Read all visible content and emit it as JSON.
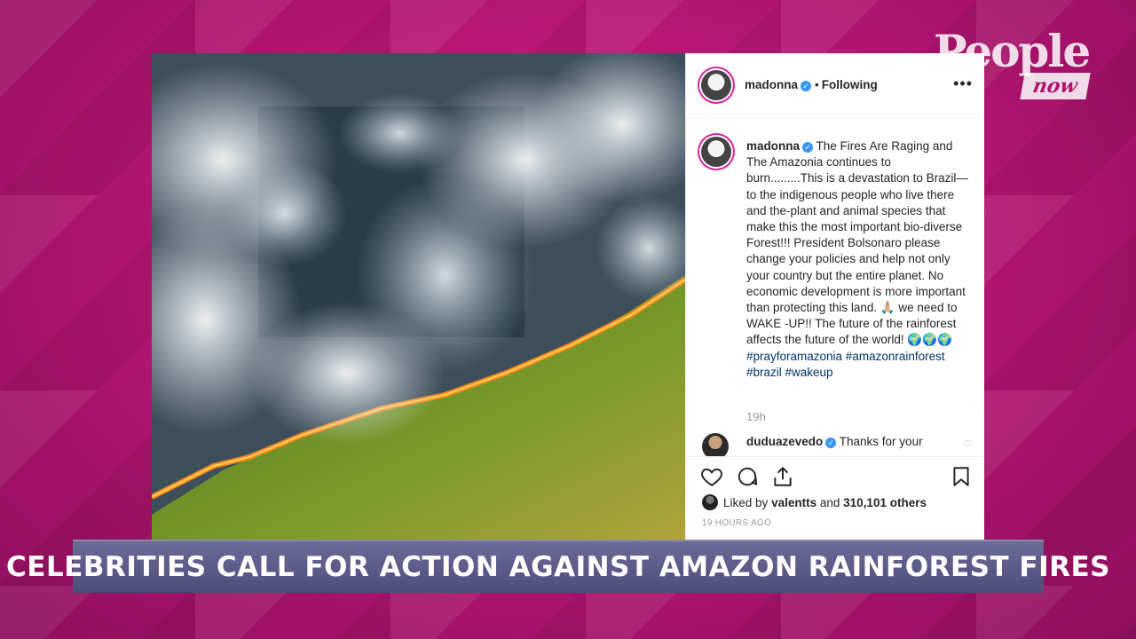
{
  "brand": {
    "name": "People",
    "sub": "now"
  },
  "post": {
    "header": {
      "username": "madonna",
      "separator": "•",
      "follow_status": "Following",
      "more_icon": "more-options-icon"
    },
    "caption": {
      "username": "madonna",
      "text": "The Fires Are Raging and The Amazonia continues to burn.........This is a devastation to Brazil—to the indigenous people who live there and the-plant and animal species that make this the most important bio-diverse Forest!!! President Bolsonaro please change your policies and help not only your country but the entire planet. No economic development is more important than protecting this land. 🙏🏼 we need to WAKE -UP!! The future of the rainforest affects the future of the world! 🌍🌍🌍",
      "hashtags": "#prayforamazonia #amazonrainforest #brazil #wakeup",
      "time": "19h"
    },
    "reply": {
      "username": "duduazevedo",
      "text": "Thanks for your"
    },
    "actions": {
      "like_icon": "heart-icon",
      "comment_icon": "comment-icon",
      "share_icon": "share-icon",
      "save_icon": "bookmark-icon"
    },
    "likes": {
      "prefix": "Liked by",
      "user": "valentts",
      "and": "and",
      "count": "310,101 others"
    },
    "timestamp": "19 HOURS AGO"
  },
  "lower_third": "CELEBRITIES CALL FOR ACTION AGAINST AMAZON RAINFOREST FIRES",
  "colors": {
    "background": "#b0146f",
    "banner": "#5b5a88",
    "verified": "#3897f0",
    "hashtag": "#003569"
  }
}
